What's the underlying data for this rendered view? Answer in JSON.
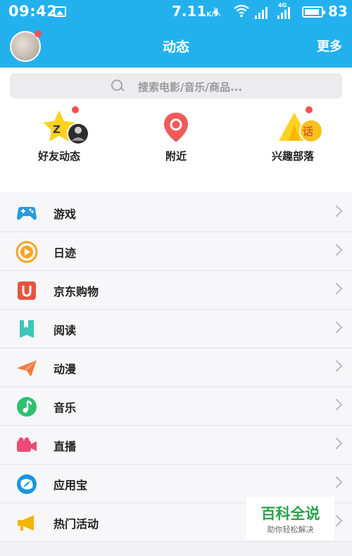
{
  "status_bar": {
    "time": "09:42",
    "net_speed": "7.11",
    "net_unit": "K/s",
    "network_type": "4G",
    "battery": "83"
  },
  "header": {
    "title": "动态",
    "more_label": "更多"
  },
  "search": {
    "placeholder": "搜索电影/音乐/商品..."
  },
  "quick_entries": [
    {
      "label": "好友动态",
      "icon": "star-friends-icon",
      "has_dot": true
    },
    {
      "label": "附近",
      "icon": "location-pin-icon",
      "has_dot": false
    },
    {
      "label": "兴趣部落",
      "icon": "tribe-tent-icon",
      "has_dot": true
    }
  ],
  "menu": [
    {
      "label": "游戏",
      "icon": "gamepad-icon",
      "color": "#2a9bdc"
    },
    {
      "label": "日迹",
      "icon": "play-circle-icon",
      "color": "#f5a623"
    },
    {
      "label": "京东购物",
      "icon": "jd-magnet-icon",
      "color": "#e8533f"
    },
    {
      "label": "阅读",
      "icon": "bookmark-icon",
      "color": "#3cc7b8"
    },
    {
      "label": "动漫",
      "icon": "paper-plane-icon",
      "color": "#f07b3f"
    },
    {
      "label": "音乐",
      "icon": "music-note-icon",
      "color": "#2fbf71"
    },
    {
      "label": "直播",
      "icon": "video-camera-icon",
      "color": "#ee4a78"
    },
    {
      "label": "应用宝",
      "icon": "app-store-icon",
      "color": "#1b95e0"
    },
    {
      "label": "热门活动",
      "icon": "megaphone-icon",
      "color": "#f4b400"
    }
  ],
  "watermark": {
    "title": "百科全说",
    "subtitle": "助你轻松解决"
  }
}
